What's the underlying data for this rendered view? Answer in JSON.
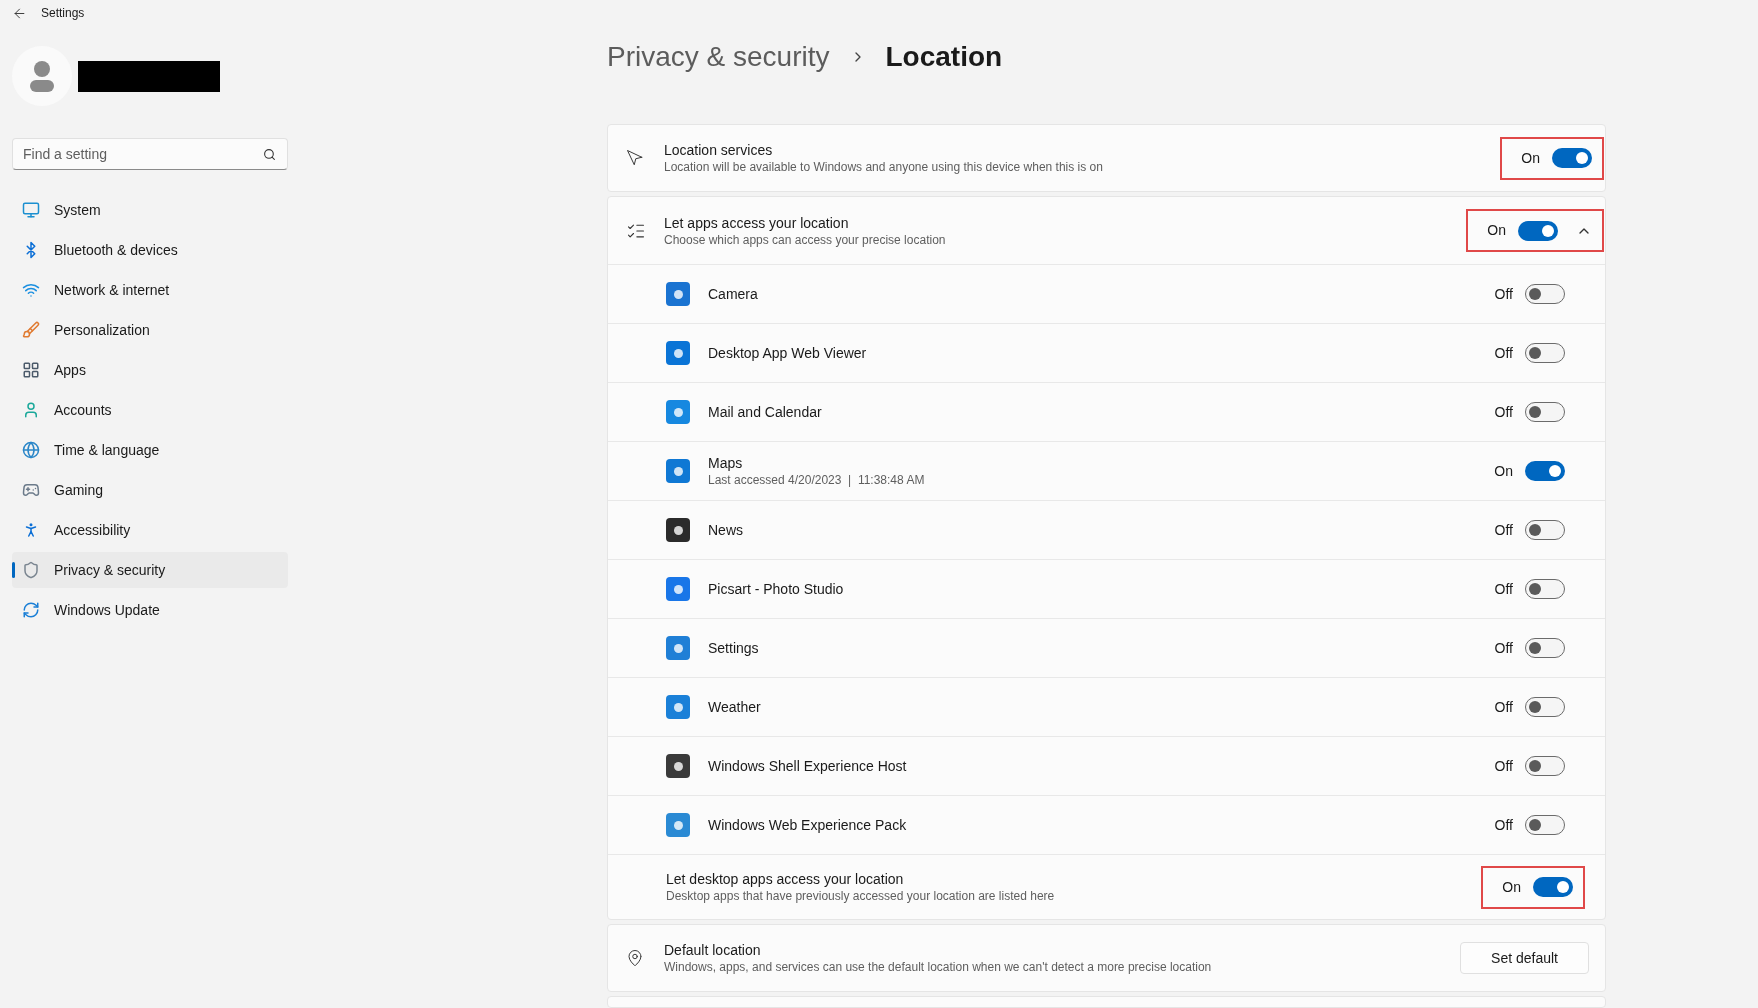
{
  "window": {
    "title": "Settings"
  },
  "search": {
    "placeholder": "Find a setting"
  },
  "sidebar": {
    "items": [
      {
        "label": "System",
        "selected": false
      },
      {
        "label": "Bluetooth & devices",
        "selected": false
      },
      {
        "label": "Network & internet",
        "selected": false
      },
      {
        "label": "Personalization",
        "selected": false
      },
      {
        "label": "Apps",
        "selected": false
      },
      {
        "label": "Accounts",
        "selected": false
      },
      {
        "label": "Time & language",
        "selected": false
      },
      {
        "label": "Gaming",
        "selected": false
      },
      {
        "label": "Accessibility",
        "selected": false
      },
      {
        "label": "Privacy & security",
        "selected": true
      },
      {
        "label": "Windows Update",
        "selected": false
      }
    ]
  },
  "breadcrumb": {
    "parent": "Privacy & security",
    "current": "Location"
  },
  "location_services": {
    "title": "Location services",
    "description": "Location will be available to Windows and anyone using this device when this is on",
    "state_label": "On",
    "on": true,
    "highlighted": true
  },
  "app_access": {
    "title": "Let apps access your location",
    "description": "Choose which apps can access your precise location",
    "state_label": "On",
    "on": true,
    "expanded": true,
    "highlighted": true,
    "apps": [
      {
        "name": "Camera",
        "state_label": "Off",
        "on": false,
        "color": "#1a73d1"
      },
      {
        "name": "Desktop App Web Viewer",
        "state_label": "Off",
        "on": false,
        "color": "#0a74d6"
      },
      {
        "name": "Mail and Calendar",
        "state_label": "Off",
        "on": false,
        "color": "#1688e0"
      },
      {
        "name": "Maps",
        "detail": "Last accessed 4/20/2023  |  11:38:48 AM",
        "state_label": "On",
        "on": true,
        "color": "#0f78d4"
      },
      {
        "name": "News",
        "state_label": "Off",
        "on": false,
        "color": "#2b2b2b"
      },
      {
        "name": "Picsart - Photo Studio",
        "state_label": "Off",
        "on": false,
        "color": "#1976e8"
      },
      {
        "name": "Settings",
        "state_label": "Off",
        "on": false,
        "color": "#1f7fd6"
      },
      {
        "name": "Weather",
        "state_label": "Off",
        "on": false,
        "color": "#1a80d8"
      },
      {
        "name": "Windows Shell Experience Host",
        "state_label": "Off",
        "on": false,
        "color": "#3a3a3a"
      },
      {
        "name": "Windows Web Experience Pack",
        "state_label": "Off",
        "on": false,
        "color": "#2a8ad4"
      }
    ]
  },
  "desktop_access": {
    "title": "Let desktop apps access your location",
    "description": "Desktop apps that have previously accessed your location are listed here",
    "state_label": "On",
    "on": true,
    "highlighted": true
  },
  "default_location": {
    "title": "Default location",
    "description": "Windows, apps, and services can use the default location when we can't detect a more precise location",
    "button": "Set default"
  }
}
